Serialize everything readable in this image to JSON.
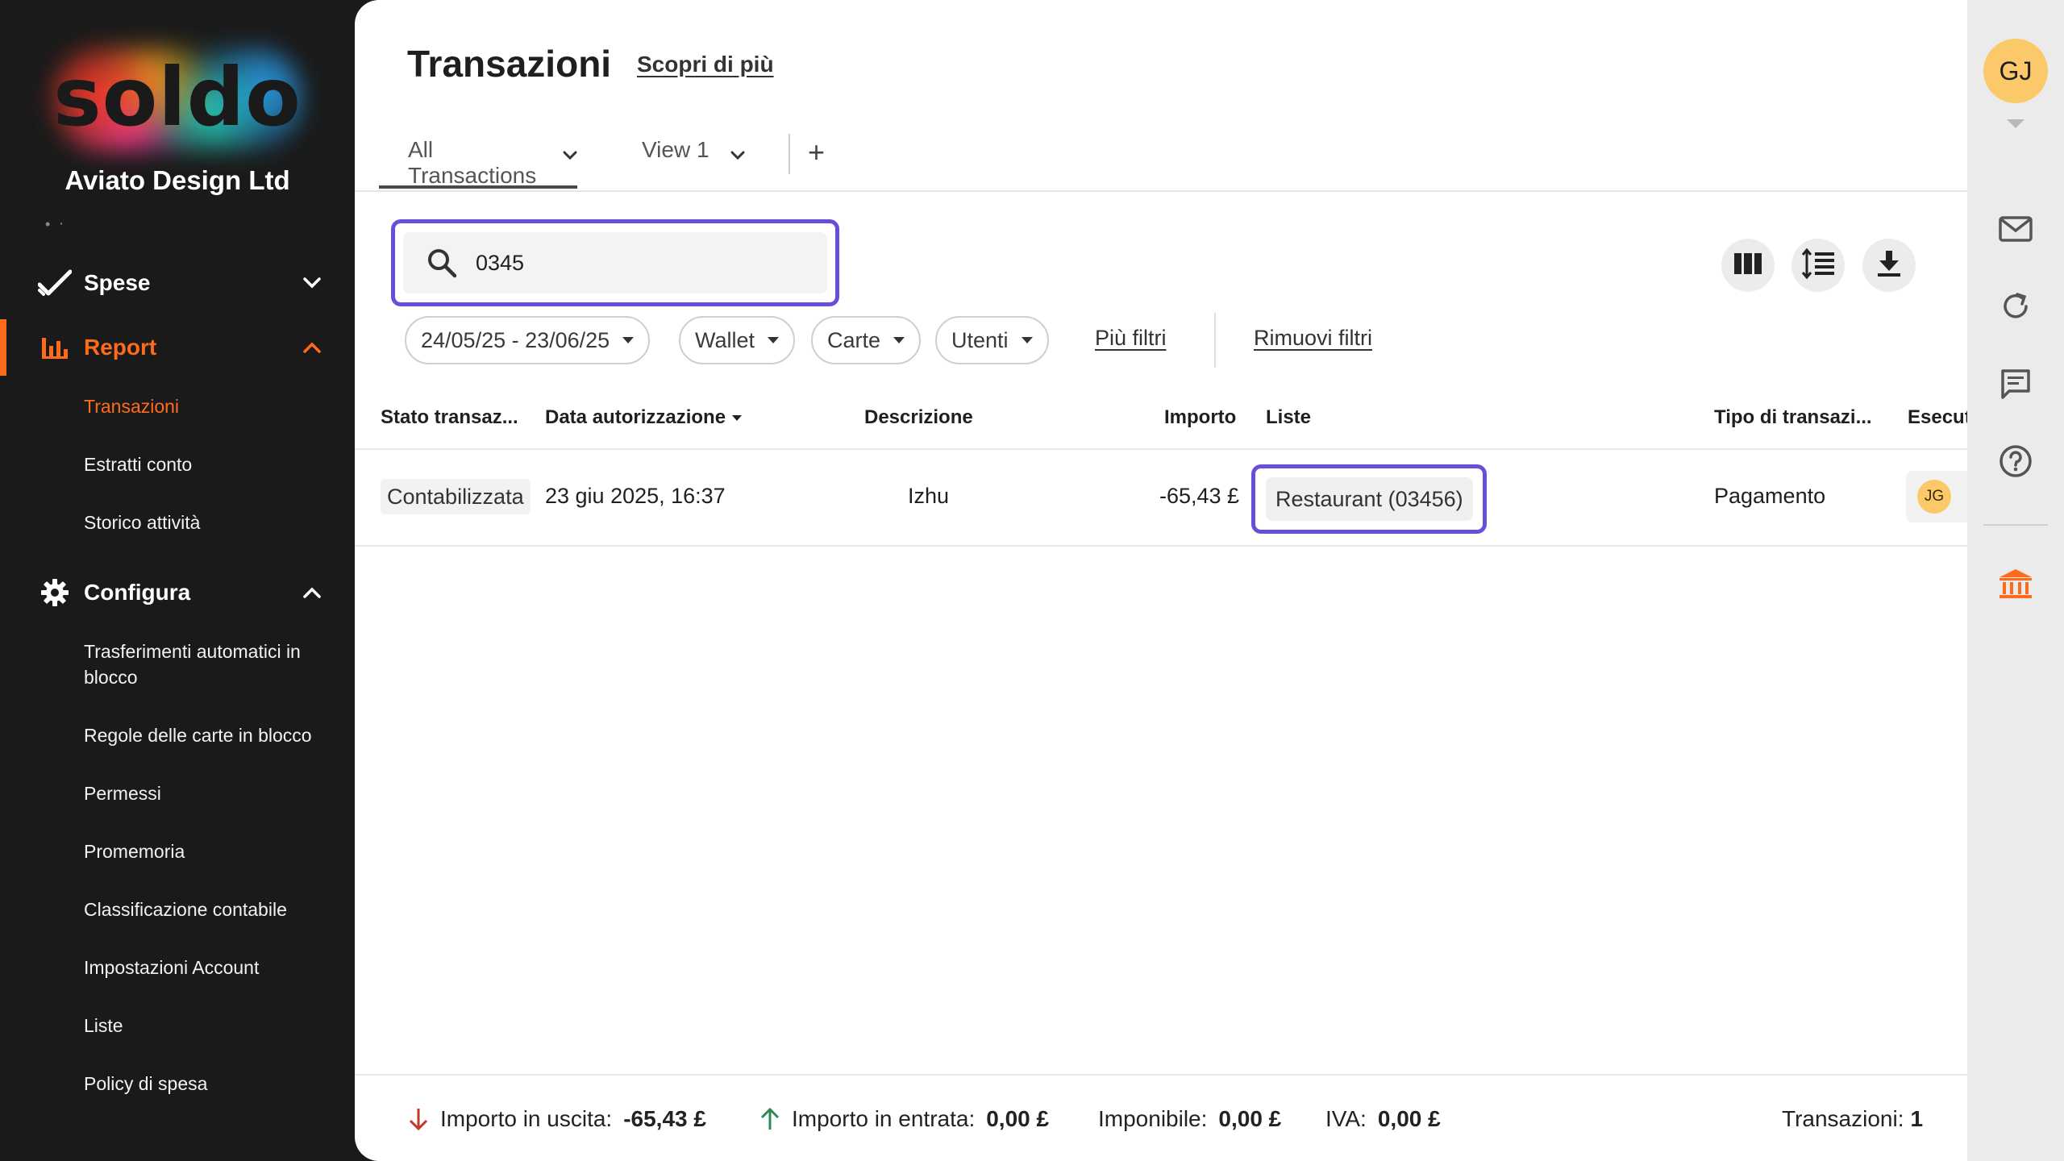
{
  "brand": {
    "logo_text": "soldo",
    "company": "Aviato Design Ltd"
  },
  "sidebar": {
    "sections": [
      {
        "label": "Spese",
        "icon": "checkmark-icon",
        "expanded": false
      },
      {
        "label": "Report",
        "icon": "bar-chart-icon",
        "expanded": true,
        "active": true
      },
      {
        "label": "Configura",
        "icon": "gear-icon",
        "expanded": true
      }
    ],
    "report_items": [
      "Transazioni",
      "Estratti conto",
      "Storico attività"
    ],
    "configura_items": [
      "Trasferimenti automatici in blocco",
      "Regole delle carte in blocco",
      "Permessi",
      "Promemoria",
      "Classificazione contabile",
      "Impostazioni Account",
      "Liste",
      "Policy di spesa"
    ],
    "accent_color": "#ff6b1a"
  },
  "header": {
    "title": "Transazioni",
    "learn_more": "Scopri di più"
  },
  "tabs": [
    {
      "label": "All Transactions",
      "active": true
    },
    {
      "label": "View 1",
      "active": false
    }
  ],
  "tab_add": "+",
  "search": {
    "value": "0345",
    "highlight_color": "#6a4ddb"
  },
  "toolbar": {
    "icons": [
      "columns-icon",
      "density-icon",
      "download-icon"
    ]
  },
  "filters": {
    "chips": [
      "24/05/25 - 23/06/25",
      "Wallet",
      "Carte",
      "Utenti"
    ],
    "more_filters": "Più filtri",
    "remove_filters": "Rimuovi filtri"
  },
  "table": {
    "columns": [
      "Stato transaz...",
      "Data autorizzazione",
      "Descrizione",
      "Importo",
      "Liste",
      "Tipo di transazi...",
      "Esecut"
    ],
    "rows": [
      {
        "status": "Contabilizzata",
        "date": "23 giu 2025, 16:37",
        "description": "Izhu",
        "amount": "-65,43 £",
        "list": "Restaurant (03456)",
        "type": "Pagamento",
        "user_initials": "JG"
      }
    ]
  },
  "footer": {
    "outgoing_label": "Importo in uscita:",
    "outgoing_value": "-65,43 £",
    "incoming_label": "Importo in entrata:",
    "incoming_value": "0,00 £",
    "taxable_label": "Imponibile:",
    "taxable_value": "0,00 £",
    "vat_label": "IVA:",
    "vat_value": "0,00 £",
    "count_label": "Transazioni:",
    "count_value": "1"
  },
  "rail": {
    "user_initials": "GJ",
    "icons": [
      "mail-icon",
      "refresh-icon",
      "chat-icon",
      "help-icon",
      "bank-icon"
    ]
  }
}
